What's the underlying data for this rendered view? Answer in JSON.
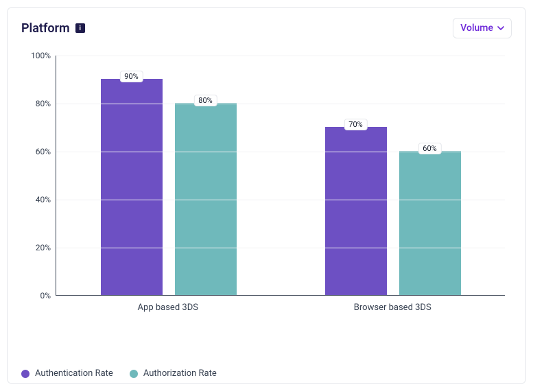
{
  "header": {
    "title": "Platform",
    "info_icon_glyph": "i",
    "dropdown_label": "Volume"
  },
  "legend": {
    "series1": "Authentication Rate",
    "series2": "Authorization Rate"
  },
  "chart_data": {
    "type": "bar",
    "title": "Platform",
    "xlabel": "",
    "ylabel": "",
    "ylim": [
      0,
      100
    ],
    "ytick_format": "percent",
    "yticks": [
      0,
      20,
      40,
      60,
      80,
      100
    ],
    "categories": [
      "App based 3DS",
      "Browser based 3DS"
    ],
    "series": [
      {
        "name": "Authentication Rate",
        "color": "#6d50c3",
        "values": [
          90,
          70
        ]
      },
      {
        "name": "Authorization Rate",
        "color": "#6fb9bb",
        "values": [
          80,
          60
        ]
      }
    ],
    "value_label_suffix": "%"
  }
}
